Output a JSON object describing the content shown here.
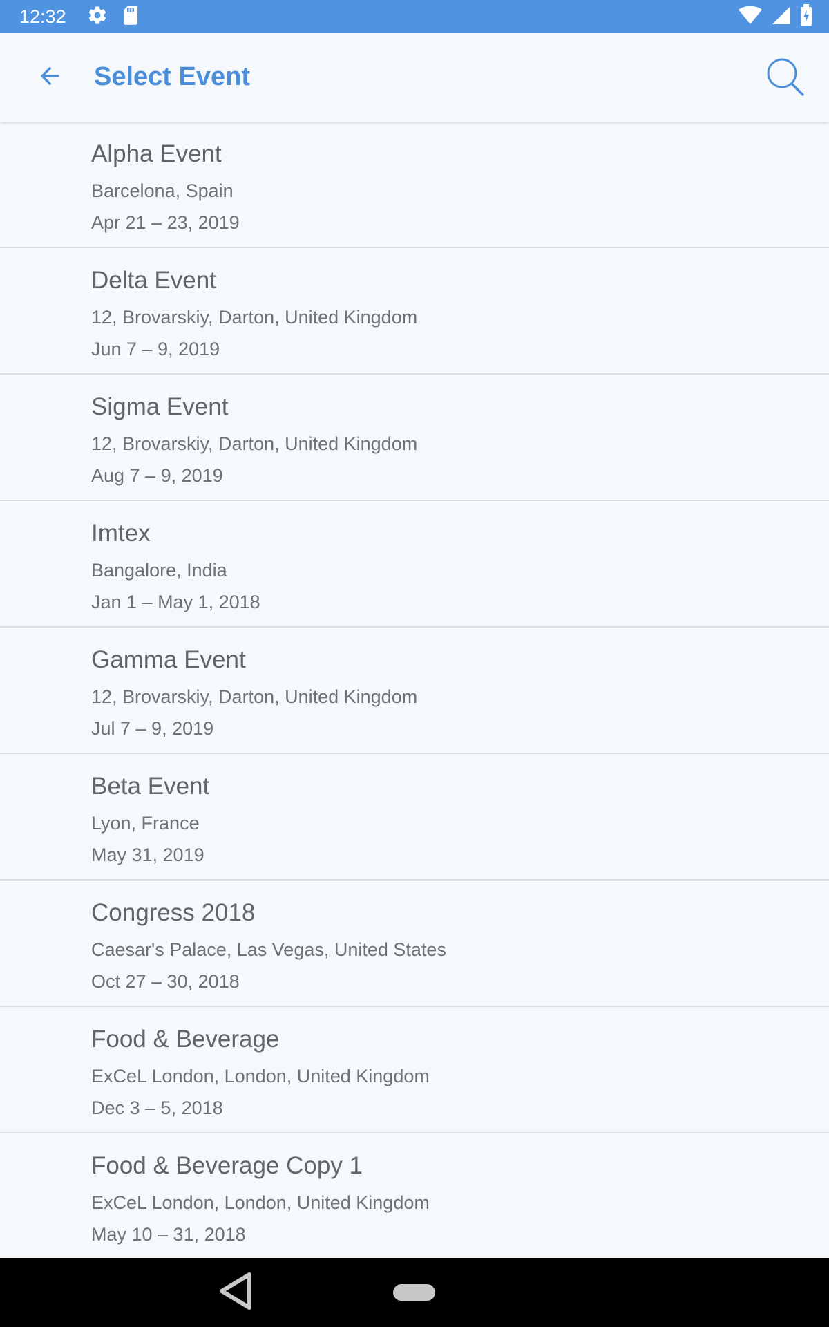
{
  "status_bar": {
    "time": "12:32",
    "icons": [
      "settings-icon",
      "sd-card-icon",
      "wifi-icon",
      "cell-signal-icon",
      "battery-charging-icon"
    ]
  },
  "app_bar": {
    "title": "Select Event",
    "back_icon": "arrow-back-icon",
    "search_icon": "search-icon"
  },
  "events": [
    {
      "name": "Alpha Event",
      "location": "Barcelona, Spain",
      "dates": "Apr 21 – 23, 2019"
    },
    {
      "name": "Delta Event",
      "location": "12, Brovarskiy, Darton, United Kingdom",
      "dates": "Jun 7 – 9, 2019"
    },
    {
      "name": "Sigma Event",
      "location": "12, Brovarskiy, Darton, United Kingdom",
      "dates": "Aug 7 – 9, 2019"
    },
    {
      "name": "Imtex",
      "location": "Bangalore, India",
      "dates": "Jan 1 – May 1, 2018"
    },
    {
      "name": "Gamma Event",
      "location": "12, Brovarskiy, Darton, United Kingdom",
      "dates": "Jul 7 – 9, 2019"
    },
    {
      "name": "Beta Event",
      "location": "Lyon, France",
      "dates": "May 31, 2019"
    },
    {
      "name": "Congress 2018",
      "location": "Caesar's Palace, Las Vegas, United States",
      "dates": "Oct 27 – 30, 2018"
    },
    {
      "name": "Food & Beverage",
      "location": "ExCeL London, London, United Kingdom",
      "dates": "Dec 3 – 5, 2018"
    },
    {
      "name": "Food & Beverage Copy 1",
      "location": "ExCeL London, London, United Kingdom",
      "dates": "May 10 – 31, 2018"
    }
  ],
  "nav_bar": {
    "back_icon": "nav-back-triangle-icon",
    "home_icon": "home-pill-icon"
  },
  "colors": {
    "status_bar": "#5093e1",
    "accent": "#4a8ed9",
    "background": "#f6f9fc",
    "divider": "#d9dce0",
    "nav_bar": "#000000"
  }
}
